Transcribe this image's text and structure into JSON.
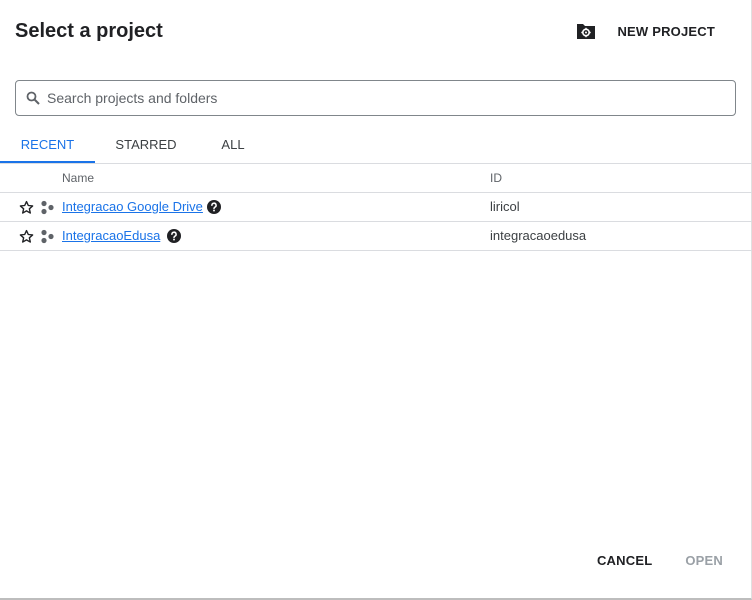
{
  "dialog": {
    "title": "Select a project",
    "new_project_label": "NEW PROJECT"
  },
  "search": {
    "placeholder": "Search projects and folders",
    "value": ""
  },
  "tabs": [
    {
      "label": "RECENT",
      "active": true
    },
    {
      "label": "STARRED",
      "active": false
    },
    {
      "label": "ALL",
      "active": false
    }
  ],
  "table": {
    "columns": {
      "name": "Name",
      "id": "ID"
    },
    "rows": [
      {
        "name": "Integracao Google Drive",
        "id": "liricol"
      },
      {
        "name": "IntegracaoEdusa",
        "id": "integracaoedusa"
      }
    ]
  },
  "footer": {
    "cancel_label": "CANCEL",
    "open_label": "OPEN"
  },
  "colors": {
    "accent": "#1a73e8",
    "text": "#202124",
    "disabled": "#9aa0a6",
    "border": "#dadce0"
  },
  "icons": {
    "new_project": "folder-gear-icon",
    "search": "search-icon",
    "star": "star-outline-icon",
    "project": "project-hexagon-icon",
    "help": "help-circle-icon"
  }
}
